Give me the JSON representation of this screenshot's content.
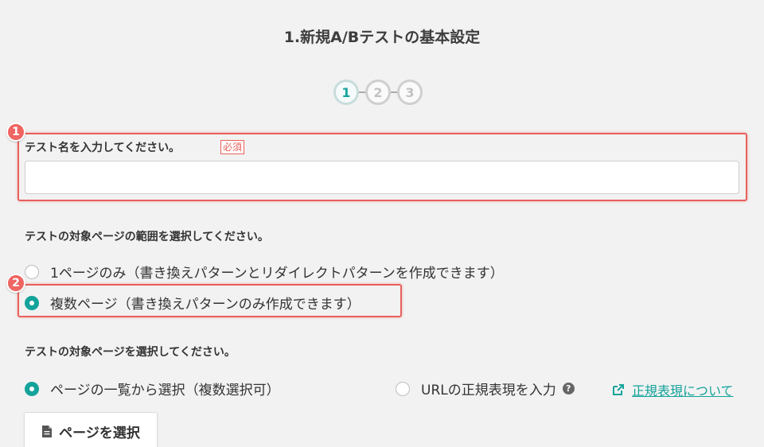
{
  "title": "1.新規A/Bテストの基本設定",
  "stepper": {
    "steps": [
      "1",
      "2",
      "3"
    ],
    "active": 1
  },
  "annotations": {
    "badge1": "1",
    "badge2": "2"
  },
  "test_name": {
    "label": "テスト名を入力してください。",
    "required": "必須",
    "value": "",
    "placeholder": ""
  },
  "scope": {
    "label": "テストの対象ページの範囲を選択してください。",
    "options": [
      {
        "label": "1ページのみ（書き換えパターンとリダイレクトパターンを作成できます）",
        "selected": false
      },
      {
        "label": "複数ページ（書き換えパターンのみ作成できます）",
        "selected": true
      }
    ]
  },
  "target": {
    "label": "テストの対象ページを選択してください。",
    "options": [
      {
        "label": "ページの一覧から選択（複数選択可）",
        "selected": true
      },
      {
        "label": "URLの正規表現を入力",
        "selected": false
      }
    ],
    "help_icon": "question-circle-icon",
    "regex_link": "正規表現について",
    "link_icon": "external-link-icon"
  },
  "select_page_button": {
    "label": "ページを選択",
    "icon": "document-icon"
  },
  "colors": {
    "accent": "#14a39b",
    "annotation": "#e8605c"
  }
}
